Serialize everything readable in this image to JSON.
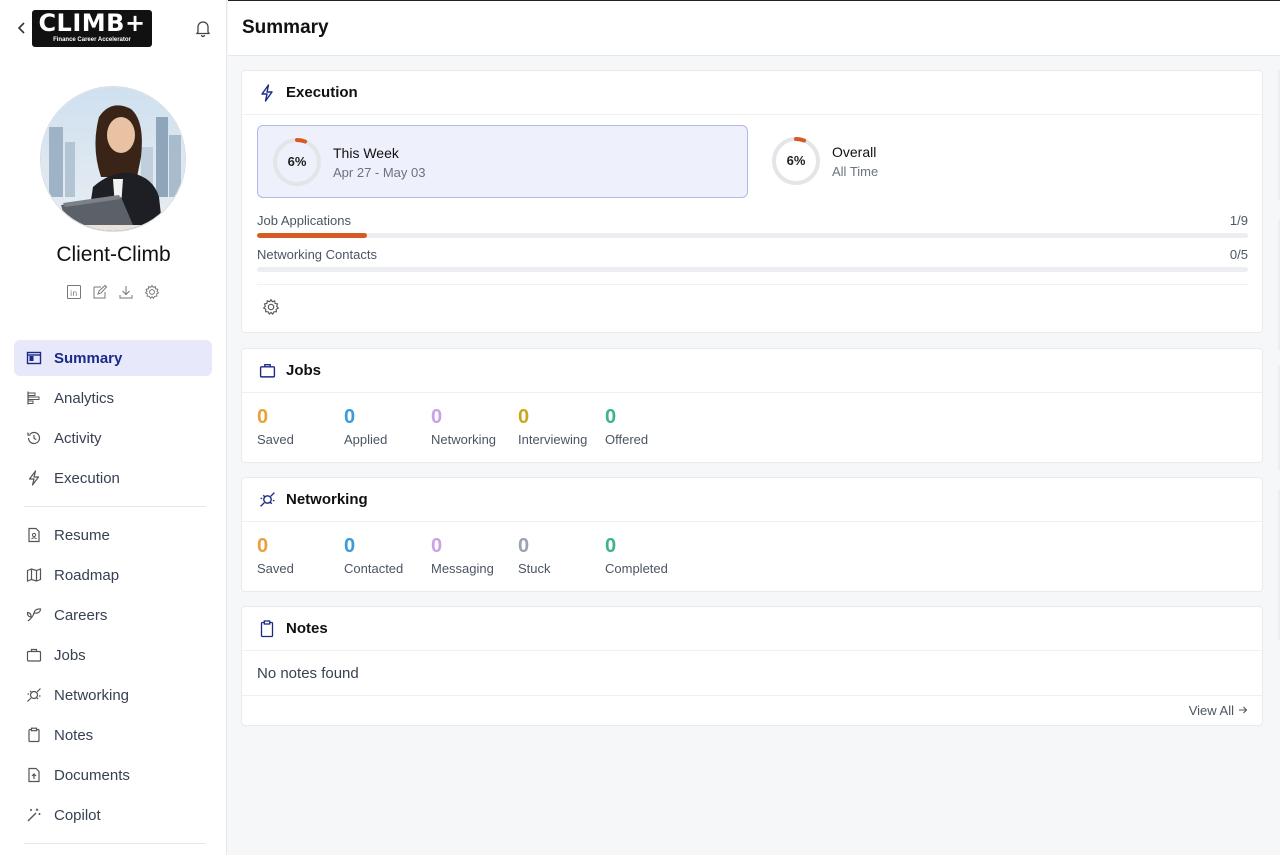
{
  "sidebar": {
    "logo": {
      "main": "CLIMB+",
      "sub": "Finance Career Accelerator"
    },
    "profile_name": "Client-Climb",
    "profile_actions": [
      "linkedin-icon",
      "edit-icon",
      "download-icon",
      "settings-icon"
    ],
    "nav_primary": [
      {
        "label": "Summary",
        "icon": "summary-icon",
        "active": true
      },
      {
        "label": "Analytics",
        "icon": "analytics-icon"
      },
      {
        "label": "Activity",
        "icon": "history-icon"
      },
      {
        "label": "Execution",
        "icon": "lightning-icon"
      }
    ],
    "nav_secondary": [
      {
        "label": "Resume",
        "icon": "resume-icon"
      },
      {
        "label": "Roadmap",
        "icon": "map-icon"
      },
      {
        "label": "Careers",
        "icon": "sprout-icon"
      },
      {
        "label": "Jobs",
        "icon": "briefcase-icon"
      },
      {
        "label": "Networking",
        "icon": "plug-icon"
      },
      {
        "label": "Notes",
        "icon": "clipboard-icon"
      },
      {
        "label": "Documents",
        "icon": "document-upload-icon"
      },
      {
        "label": "Copilot",
        "icon": "magic-wand-icon"
      }
    ]
  },
  "header": {
    "title": "Summary"
  },
  "execution": {
    "title": "Execution",
    "this_week": {
      "percent": "6%",
      "progress": 0.06,
      "title": "This Week",
      "range": "Apr 27 - May 03"
    },
    "overall": {
      "percent": "6%",
      "progress": 0.06,
      "title": "Overall",
      "range": "All Time"
    },
    "metrics": [
      {
        "label": "Job Applications",
        "value": "1/9",
        "progress": 0.111
      },
      {
        "label": "Networking Contacts",
        "value": "0/5",
        "progress": 0
      }
    ]
  },
  "jobs": {
    "title": "Jobs",
    "stats": [
      {
        "value": "0",
        "label": "Saved",
        "color": "#e9a23b"
      },
      {
        "value": "0",
        "label": "Applied",
        "color": "#3b9ad9"
      },
      {
        "value": "0",
        "label": "Networking",
        "color": "#c9a2e6"
      },
      {
        "value": "0",
        "label": "Interviewing",
        "color": "#c9a91c"
      },
      {
        "value": "0",
        "label": "Offered",
        "color": "#3bb38f"
      }
    ]
  },
  "networking": {
    "title": "Networking",
    "stats": [
      {
        "value": "0",
        "label": "Saved",
        "color": "#e9a23b"
      },
      {
        "value": "0",
        "label": "Contacted",
        "color": "#3b9ad9"
      },
      {
        "value": "0",
        "label": "Messaging",
        "color": "#c9a2e6"
      },
      {
        "value": "0",
        "label": "Stuck",
        "color": "#9ca3af"
      },
      {
        "value": "0",
        "label": "Completed",
        "color": "#3bb38f"
      }
    ]
  },
  "notes": {
    "title": "Notes",
    "empty": "No notes found",
    "view_all": "View All"
  },
  "colors": {
    "accent": "#1b2a86",
    "active_bg": "#e7e9fb",
    "progress": "#d65a24"
  }
}
